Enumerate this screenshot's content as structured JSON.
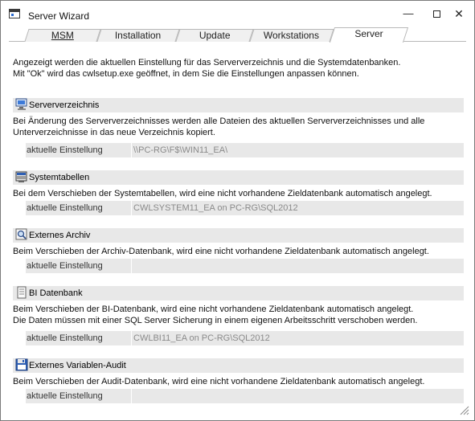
{
  "window": {
    "title": "Server Wizard",
    "minimize_glyph": "—",
    "close_glyph": "✕"
  },
  "tabs": [
    {
      "label": "MSM",
      "active": false
    },
    {
      "label": "Installation",
      "active": false
    },
    {
      "label": "Update",
      "active": false
    },
    {
      "label": "Workstations",
      "active": false
    },
    {
      "label": "Server",
      "active": true
    }
  ],
  "intro": {
    "line1": "Angezeigt werden die aktuellen Einstellung für das Serververzeichnis und die Systemdatenbanken.",
    "line2": "Mit \"Ok\" wird das cwlsetup.exe geöffnet, in dem Sie die Einstellungen anpassen können."
  },
  "sections": [
    {
      "title": "Serververzeichnis",
      "icon": "computer-icon",
      "desc_lines": [
        "Bei Änderung des Serververzeichnisses werden alle Dateien des aktuellen Serververzeichnisses und alle",
        "Unterverzeichnisse in das neue Verzeichnis kopiert."
      ],
      "setting_label": "aktuelle Einstellung",
      "setting_value": "\\\\PC-RG\\F$\\WIN11_EA\\"
    },
    {
      "title": "Systemtabellen",
      "icon": "database-icon",
      "desc_lines": [
        "Bei dem Verschieben der Systemtabellen, wird eine nicht vorhandene Zieldatenbank automatisch angelegt."
      ],
      "setting_label": "aktuelle Einstellung",
      "setting_value": "CWLSYSTEM11_EA on PC-RG\\SQL2012"
    },
    {
      "title": "Externes Archiv",
      "icon": "archive-search-icon",
      "desc_lines": [
        "Beim Verschieben der Archiv-Datenbank, wird eine nicht vorhandene Zieldatenbank automatisch angelegt."
      ],
      "setting_label": "aktuelle Einstellung",
      "setting_value": ""
    },
    {
      "title": "BI Datenbank",
      "icon": "document-icon",
      "desc_lines": [
        "Beim Verschieben der BI-Datenbank, wird eine nicht vorhandene Zieldatenbank automatisch angelegt.",
        "Die Daten müssen mit einer SQL Server Sicherung in einem eigenen Arbeitsschritt verschoben werden."
      ],
      "setting_label": "aktuelle Einstellung",
      "setting_value": "CWLBI11_EA on PC-RG\\SQL2012"
    },
    {
      "title": "Externes Variablen-Audit",
      "icon": "floppy-disk-icon",
      "desc_lines": [
        "Beim Verschieben der Audit-Datenbank, wird eine nicht vorhandene Zieldatenbank automatisch angelegt."
      ],
      "setting_label": "aktuelle Einstellung",
      "setting_value": ""
    }
  ]
}
